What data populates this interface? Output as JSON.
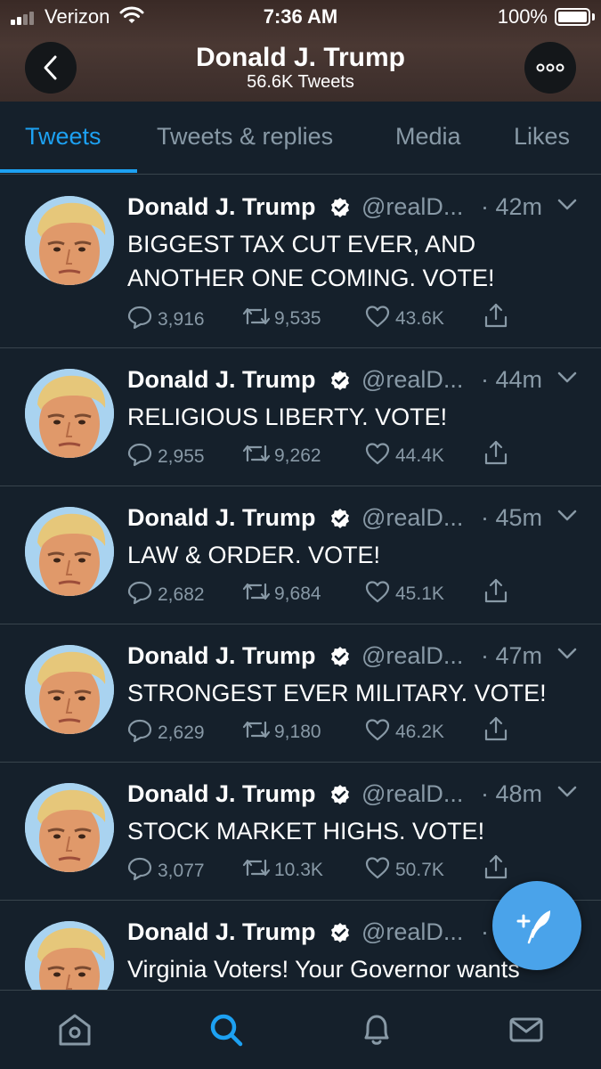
{
  "status_bar": {
    "carrier": "Verizon",
    "time": "7:36 AM",
    "battery": "100%",
    "signal_bars": 2,
    "battery_level": 1.0
  },
  "profile": {
    "name": "Donald J. Trump",
    "tweet_count": "56.6K Tweets"
  },
  "tabs": [
    {
      "label": "Tweets",
      "active": true
    },
    {
      "label": "Tweets & replies",
      "active": false
    },
    {
      "label": "Media",
      "active": false
    },
    {
      "label": "Likes",
      "active": false
    }
  ],
  "tweets": [
    {
      "name": "Donald J. Trump",
      "handle": "@realD...",
      "time": "· 42m",
      "text": "BIGGEST TAX CUT EVER, AND ANOTHER ONE COMING. VOTE!",
      "replies": "3,916",
      "retweets": "9,535",
      "likes": "43.6K"
    },
    {
      "name": "Donald J. Trump",
      "handle": "@realD...",
      "time": "· 44m",
      "text": "RELIGIOUS LIBERTY. VOTE!",
      "replies": "2,955",
      "retweets": "9,262",
      "likes": "44.4K"
    },
    {
      "name": "Donald J. Trump",
      "handle": "@realD...",
      "time": "· 45m",
      "text": "LAW & ORDER. VOTE!",
      "replies": "2,682",
      "retweets": "9,684",
      "likes": "45.1K"
    },
    {
      "name": "Donald J. Trump",
      "handle": "@realD...",
      "time": "· 47m",
      "text": "STRONGEST EVER MILITARY. VOTE!",
      "replies": "2,629",
      "retweets": "9,180",
      "likes": "46.2K"
    },
    {
      "name": "Donald J. Trump",
      "handle": "@realD...",
      "time": "· 48m",
      "text": "STOCK MARKET HIGHS. VOTE!",
      "replies": "3,077",
      "retweets": "10.3K",
      "likes": "50.7K"
    },
    {
      "name": "Donald J. Trump",
      "handle": "@realD...",
      "time": "·",
      "text": "Virginia Voters! Your Governor wants",
      "replies": "",
      "retweets": "",
      "likes": ""
    }
  ],
  "bottom_nav": [
    "home-icon",
    "search-icon",
    "notifications-icon",
    "messages-icon"
  ],
  "colors": {
    "background": "#15202b",
    "accent": "#1da1f2",
    "muted": "#8899a6",
    "divider": "#38444d"
  }
}
